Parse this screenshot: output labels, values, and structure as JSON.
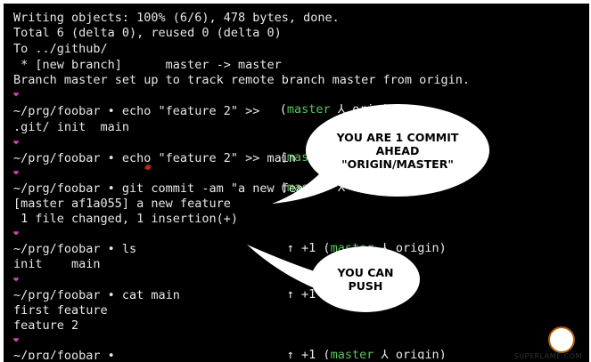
{
  "terminal": {
    "lines": [
      "Writing objects: 100% (6/6), 478 bytes, done.",
      "Total 6 (delta 0), reused 0 (delta 0)",
      "To ../github/",
      " * [new branch]      master -> master",
      "Branch master set up to track remote branch master from origin.",
      "~/prg/foobar • echo \"feature 2\" >>",
      ".git/ init  main",
      "~/prg/foobar • echo \"feature 2\" >> main",
      "~/prg/foobar • git commit -am \"a new fea",
      "[master af1a055] a new feature",
      " 1 file changed, 1 insertion(+)",
      "~/prg/foobar • ls",
      "init    main",
      "~/prg/foobar • cat main",
      "first feature",
      "feature 2",
      "~/prg/foobar •"
    ],
    "heart_symbol": "❤",
    "status_1": {
      "open": "(",
      "branch": "master",
      "sep": " ⅄ ",
      "remote": "origin",
      "close": ")"
    },
    "status_2": {
      "open": "(",
      "branch": "master",
      "sep": " ⅄"
    },
    "status_3": {
      "open": "(",
      "branch": "master",
      "sep": " ⅄"
    },
    "status_4": {
      "ahead": "↑ +1 ",
      "open": "(",
      "branch": "master",
      "sep": " ⅄ ",
      "remote": "origin",
      "close": ")"
    },
    "status_5": {
      "ahead": "↑ +1 ",
      "open": "(",
      "branch": "mas"
    },
    "status_6": {
      "ahead": "↑ +1 ",
      "open": "(",
      "branch": "master",
      "sep": " ⅄ ",
      "remote": "origin",
      "close": ")"
    }
  },
  "bubbles": {
    "ahead": [
      "YOU ARE 1 COMMIT",
      "AHEAD",
      "\"ORIGIN/MASTER\""
    ],
    "push": [
      "YOU CAN",
      "PUSH"
    ]
  },
  "watermark": "SUPERLAME.COM",
  "colors": {
    "prompt_heart": "#d244b2",
    "branch": "#58c65a",
    "terminal_bg": "#000000",
    "text": "#e8e8e8"
  }
}
